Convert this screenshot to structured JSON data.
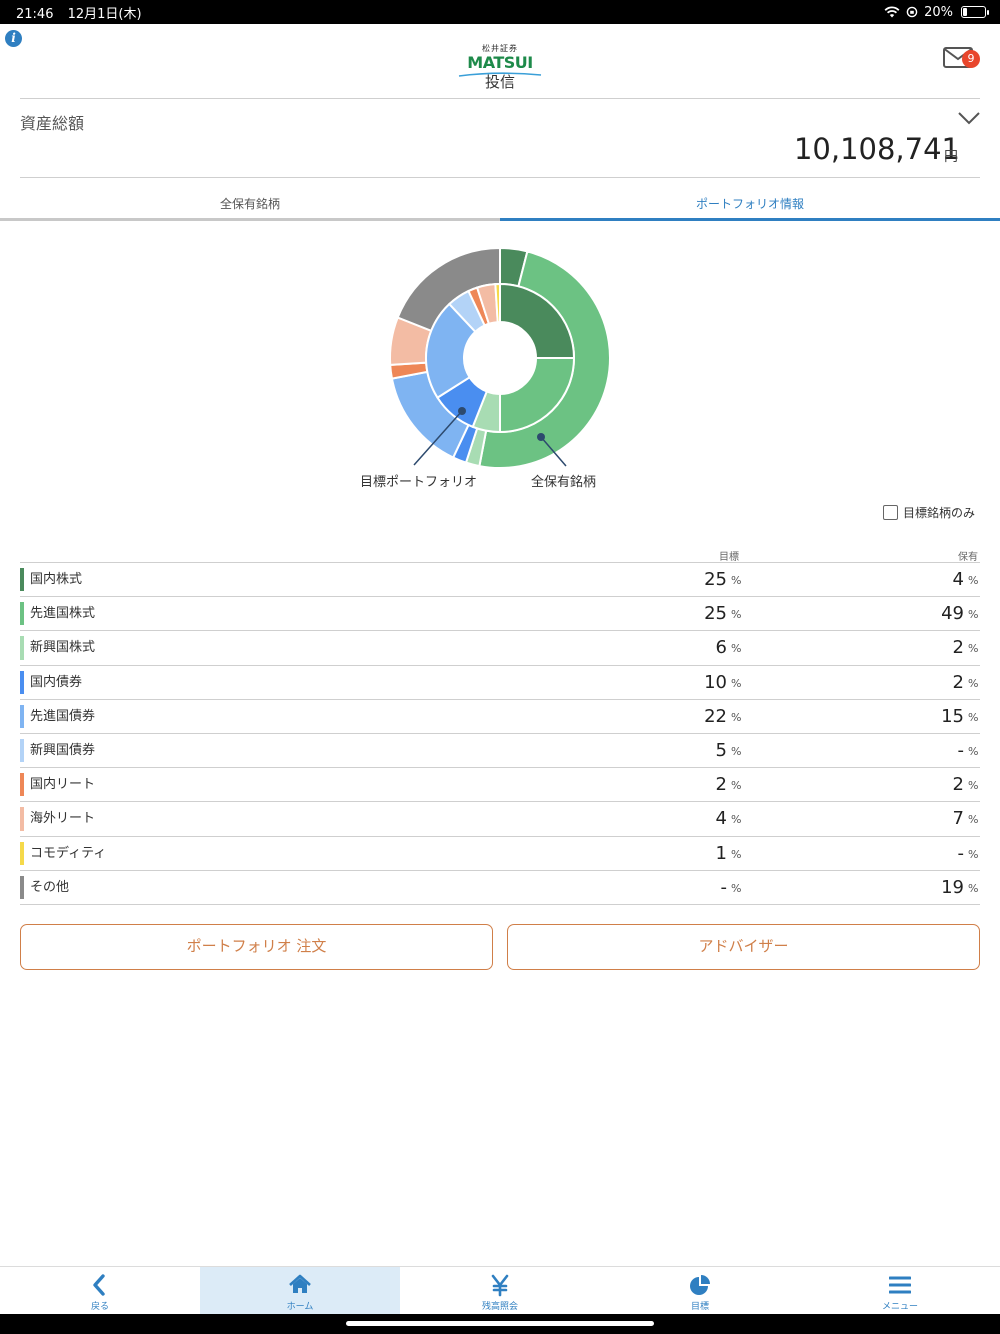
{
  "status_bar": {
    "time": "21:46",
    "date": "12月1日(木)",
    "battery": "20%",
    "battery_level": 0.2
  },
  "header": {
    "logo_small": "松井証券",
    "logo_brand": "MATSUI",
    "logo_sub": "投信",
    "mail_badge": "9",
    "colors": {
      "accent": "#2f7fc1",
      "badge": "#e8462c",
      "brand": "#1e8a4a"
    }
  },
  "asset": {
    "label": "資産総額",
    "value": "10,108,741",
    "unit": "円"
  },
  "tabs": [
    {
      "label": "全保有銘柄",
      "active": false
    },
    {
      "label": "ポートフォリオ情報",
      "active": true
    }
  ],
  "chart_data": {
    "type": "pie",
    "subtype": "double-donut",
    "inner_series_name": "目標ポートフォリオ",
    "outer_series_name": "全保有銘柄",
    "categories": [
      "国内株式",
      "先進国株式",
      "新興国株式",
      "国内債券",
      "先進国債券",
      "新興国債券",
      "国内リート",
      "海外リート",
      "コモディティ",
      "その他"
    ],
    "colors": [
      "#4a8a5c",
      "#6cc283",
      "#a8dcb3",
      "#4a8ef0",
      "#7fb4f2",
      "#b3d3f7",
      "#ee8757",
      "#f3bca4",
      "#f5d94a",
      "#8a8a8a"
    ],
    "series": [
      {
        "name": "目標ポートフォリオ",
        "values": [
          25,
          25,
          6,
          10,
          22,
          5,
          2,
          4,
          1,
          0
        ]
      },
      {
        "name": "全保有銘柄",
        "values": [
          4,
          49,
          2,
          2,
          15,
          0,
          2,
          7,
          0,
          19
        ]
      }
    ]
  },
  "filter": {
    "label": "目標銘柄のみ",
    "checked": false
  },
  "table": {
    "headers": {
      "target": "目標",
      "holding": "保有"
    },
    "unit": "%",
    "rows": [
      {
        "name": "国内株式",
        "target": "25",
        "holding": "4",
        "color": "#4a8a5c"
      },
      {
        "name": "先進国株式",
        "target": "25",
        "holding": "49",
        "color": "#6cc283"
      },
      {
        "name": "新興国株式",
        "target": "6",
        "holding": "2",
        "color": "#a8dcb3"
      },
      {
        "name": "国内債券",
        "target": "10",
        "holding": "2",
        "color": "#4a8ef0"
      },
      {
        "name": "先進国債券",
        "target": "22",
        "holding": "15",
        "color": "#7fb4f2"
      },
      {
        "name": "新興国債券",
        "target": "5",
        "holding": "-",
        "color": "#b3d3f7"
      },
      {
        "name": "国内リート",
        "target": "2",
        "holding": "2",
        "color": "#ee8757"
      },
      {
        "name": "海外リート",
        "target": "4",
        "holding": "7",
        "color": "#f3bca4"
      },
      {
        "name": "コモディティ",
        "target": "1",
        "holding": "-",
        "color": "#f5d94a"
      },
      {
        "name": "その他",
        "target": "-",
        "holding": "19",
        "color": "#8a8a8a"
      }
    ]
  },
  "buttons": {
    "portfolio_order": "ポートフォリオ 注文",
    "advisor": "アドバイザー"
  },
  "nav": [
    {
      "label": "戻る",
      "icon": "back-chevron-icon"
    },
    {
      "label": "ホーム",
      "icon": "home-icon",
      "active": true
    },
    {
      "label": "残高照会",
      "icon": "yen-icon"
    },
    {
      "label": "目標",
      "icon": "pie-chart-icon"
    },
    {
      "label": "メニュー",
      "icon": "hamburger-menu-icon"
    }
  ]
}
